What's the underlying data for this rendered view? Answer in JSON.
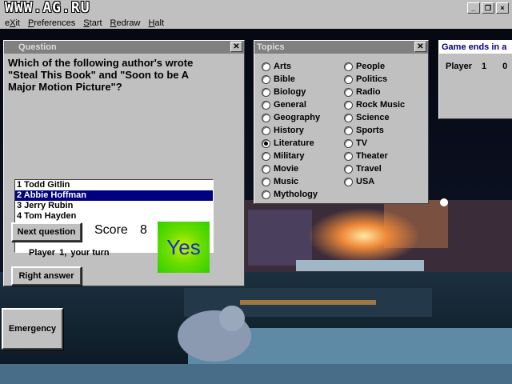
{
  "app": {
    "logo_text": "WWW.AG.RU"
  },
  "window_controls": [
    "_",
    "❐",
    "×"
  ],
  "menu": [
    {
      "pre": "e",
      "ul": "X",
      "post": "it"
    },
    {
      "pre": "",
      "ul": "P",
      "post": "references"
    },
    {
      "pre": "",
      "ul": "S",
      "post": "tart"
    },
    {
      "pre": "",
      "ul": "R",
      "post": "edraw"
    },
    {
      "pre": "",
      "ul": "H",
      "post": "alt"
    }
  ],
  "question_panel": {
    "title": "Question",
    "text": "Which of the following author's wrote \"Steal This Book\" and \"Soon to be A Major Motion Picture\"?",
    "answers": [
      "1 Todd Gitlin",
      "2 Abbie Hoffman",
      "3 Jerry Rubin",
      "4 Tom Hayden"
    ],
    "selected_index": 1,
    "next_button": "Next question",
    "score_label": "Score",
    "score_value": "8",
    "turn_player": "Player",
    "turn_number": "1,",
    "turn_suffix": "your turn",
    "right_answer_button": "Right answer",
    "result": "Yes"
  },
  "topics_panel": {
    "title": "Topics",
    "left": [
      "Arts",
      "Bible",
      "Biology",
      "General",
      "Geography",
      "History",
      "Literature",
      "Military",
      "Movie",
      "Music",
      "Mythology"
    ],
    "right": [
      "People",
      "Politics",
      "Radio",
      "Rock Music",
      "Science",
      "Sports",
      "TV",
      "Theater",
      "Travel",
      "USA"
    ],
    "selected": "Literature"
  },
  "game_panel": {
    "title": "Game ends in a",
    "player_label": "Player",
    "player_number": "1",
    "player_score": "0"
  },
  "emergency_button": "Emergency"
}
